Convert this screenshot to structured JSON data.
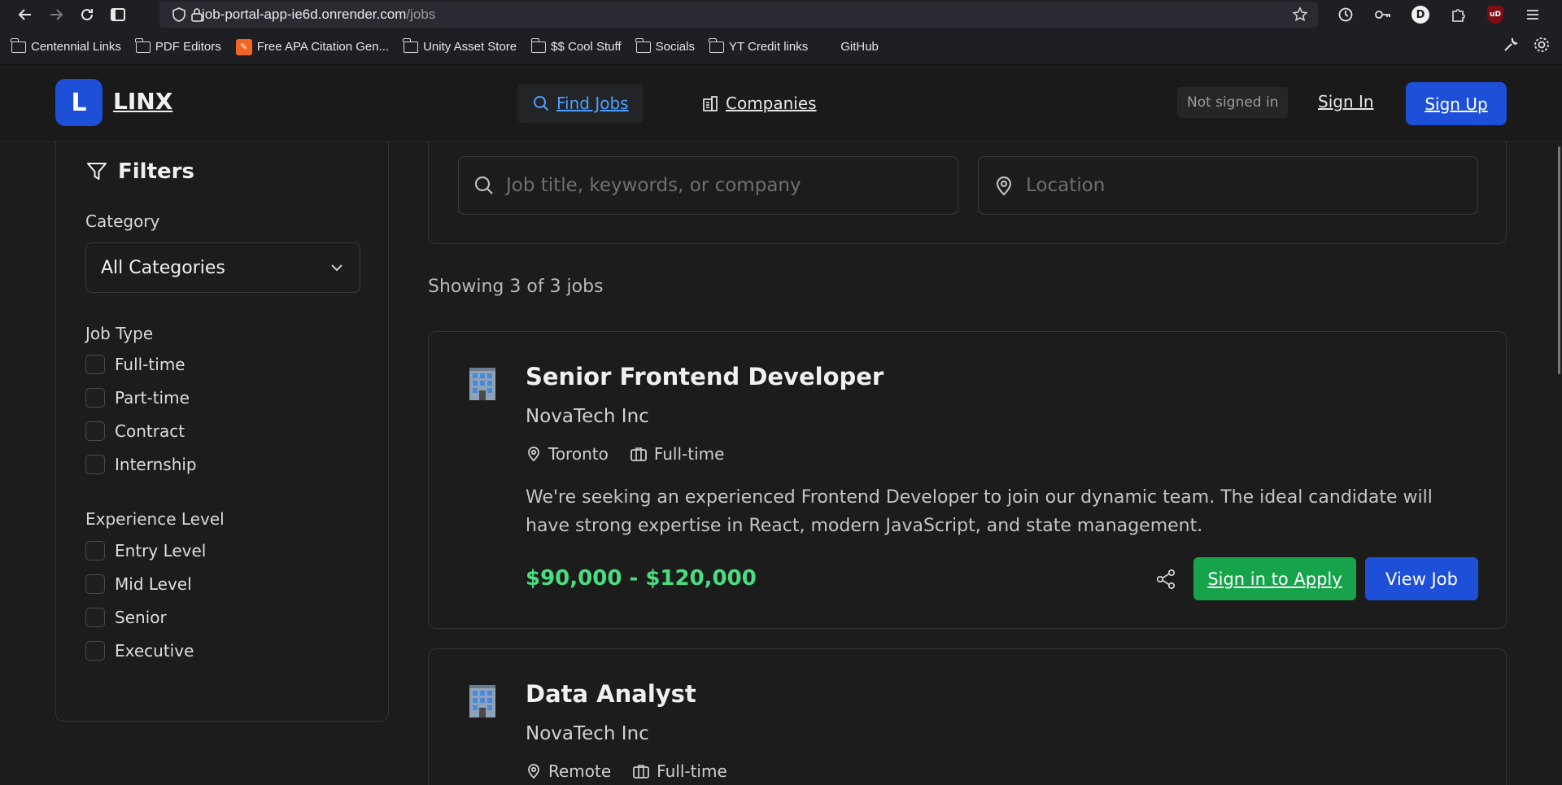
{
  "browser": {
    "url_host": "job-portal-app-ie6d.onrender.com",
    "url_path": "/jobs",
    "profile_initial": "D",
    "ublock_label": "uD",
    "bookmarks": [
      {
        "label": "Centennial Links",
        "icon": "folder-icon"
      },
      {
        "label": "PDF Editors",
        "icon": "folder-icon"
      },
      {
        "label": "Free APA Citation Gen...",
        "icon": "apa-site-icon"
      },
      {
        "label": "Unity Asset Store",
        "icon": "folder-icon"
      },
      {
        "label": "$$ Cool Stuff",
        "icon": "folder-icon"
      },
      {
        "label": "Socials",
        "icon": "folder-icon"
      },
      {
        "label": "YT Credit links",
        "icon": "folder-icon"
      },
      {
        "label": "GitHub",
        "icon": "github-icon"
      }
    ]
  },
  "header": {
    "logo_letter": "L",
    "logo_text": "LINX",
    "nav_find_jobs": "Find Jobs",
    "nav_companies": "Companies",
    "auth_status": "Not signed in",
    "sign_in": "Sign In",
    "sign_up": "Sign Up"
  },
  "filters": {
    "title": "Filters",
    "category_label": "Category",
    "category_selected": "All Categories",
    "job_type_label": "Job Type",
    "job_types": [
      "Full-time",
      "Part-time",
      "Contract",
      "Internship"
    ],
    "experience_label": "Experience Level",
    "experience_levels": [
      "Entry Level",
      "Mid Level",
      "Senior",
      "Executive"
    ]
  },
  "search": {
    "keyword_placeholder": "Job title, keywords, or company",
    "location_placeholder": "Location"
  },
  "results": {
    "count_text": "Showing 3 of 3 jobs"
  },
  "jobs": [
    {
      "title": "Senior Frontend Developer",
      "company": "NovaTech Inc",
      "location": "Toronto",
      "type": "Full-time",
      "description": "We're seeking an experienced Frontend Developer to join our dynamic team. The ideal candidate will have strong expertise in React, modern JavaScript, and state management.",
      "salary": "$90,000 - $120,000",
      "apply_label": "Sign in to Apply",
      "view_label": "View Job"
    },
    {
      "title": "Data Analyst",
      "company": "NovaTech Inc",
      "location": "Remote",
      "type": "Full-time"
    }
  ],
  "colors": {
    "accent_blue": "#1d4fd8",
    "link_blue": "#4f9fff",
    "salary_green": "#4ade80",
    "apply_green": "#16a34a",
    "background": "#1c1c1c"
  }
}
